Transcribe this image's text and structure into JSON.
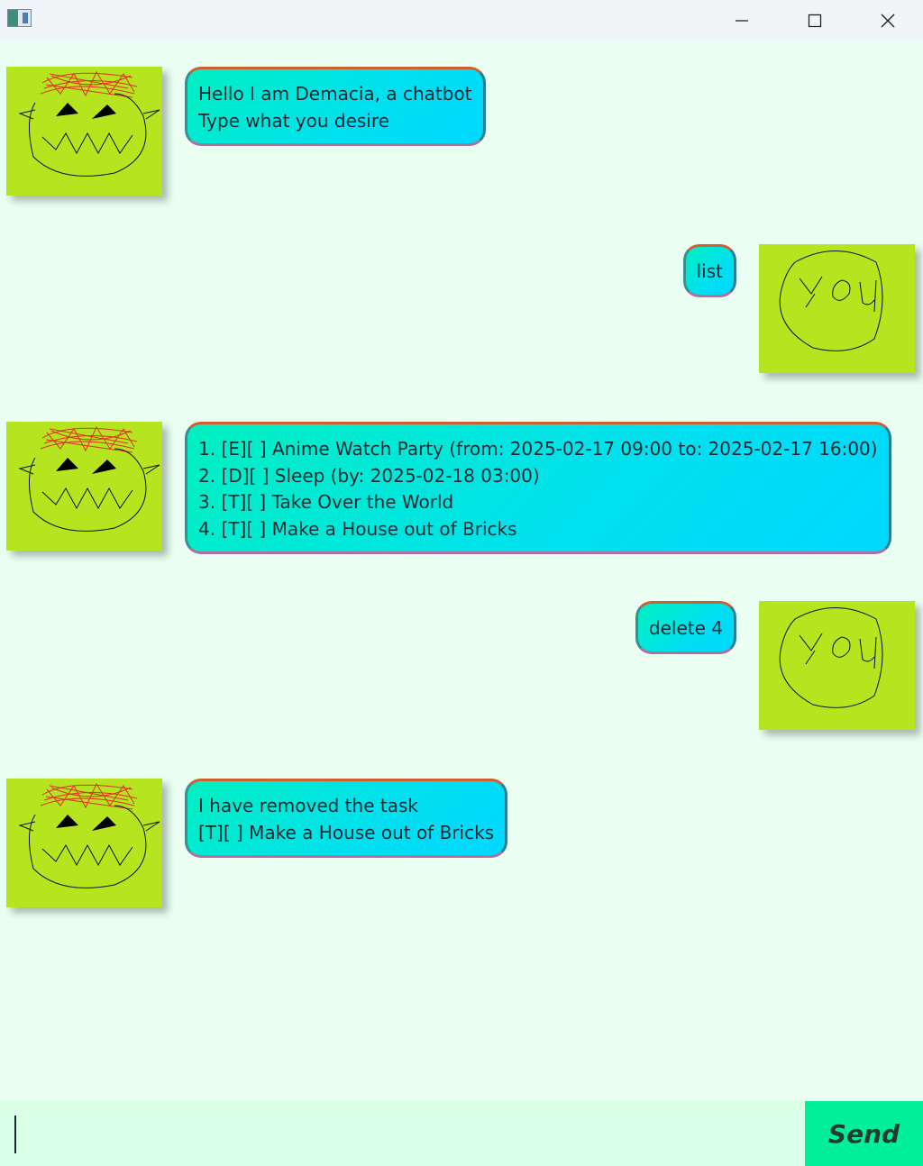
{
  "window": {
    "icons": [
      "app-icon",
      "minimize-icon",
      "maximize-icon",
      "close-icon"
    ]
  },
  "messages": [
    {
      "sender": "bot",
      "avatar": "ogre-avatar",
      "lines": [
        "Hello I am Demacia, a chatbot",
        "Type what you desire"
      ]
    },
    {
      "sender": "user",
      "avatar": "you-avatar",
      "avatar_text": "You",
      "lines": [
        "list"
      ]
    },
    {
      "sender": "bot",
      "avatar": "ogre-avatar",
      "lines": [
        "1. [E][ ] Anime Watch Party (from: 2025-02-17 09:00 to: 2025-02-17 16:00)",
        "2. [D][ ] Sleep (by: 2025-02-18 03:00)",
        "3. [T][ ] Take Over the World",
        "4. [T][ ] Make a House out of Bricks"
      ]
    },
    {
      "sender": "user",
      "avatar": "you-avatar",
      "avatar_text": "You",
      "lines": [
        "delete 4"
      ]
    },
    {
      "sender": "bot",
      "avatar": "ogre-avatar",
      "lines": [
        "I have removed the task",
        "[T][ ] Make a House out of Bricks"
      ]
    }
  ],
  "input": {
    "value": "",
    "placeholder": ""
  },
  "send_button": {
    "label": "Send"
  },
  "colors": {
    "background": "#eafff2",
    "avatar_bg": "#b6e41f",
    "bubble_from": "#00f0c0",
    "bubble_to": "#00d8ff",
    "send_bg": "#00f09a",
    "input_bg": "#d9ffe6"
  }
}
